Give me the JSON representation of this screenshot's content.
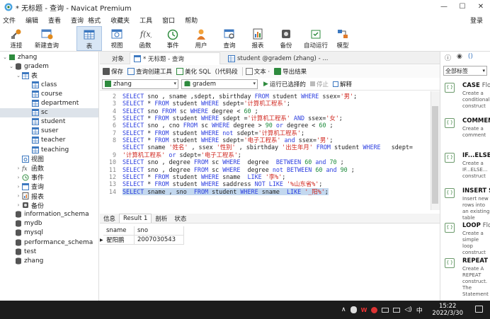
{
  "window": {
    "title": "* 无标题 - 查询 - Navicat Premium",
    "controls": [
      "—",
      "☐",
      "✕"
    ]
  },
  "menu": {
    "items": [
      "文件",
      "编辑",
      "查看",
      "查询",
      "格式",
      "收藏夹",
      "工具",
      "窗口",
      "帮助"
    ],
    "login": "登录"
  },
  "toolbar": {
    "buttons": [
      {
        "label": "连接",
        "icon": "connect-icon"
      },
      {
        "label": "新建查询",
        "icon": "new-query-icon"
      },
      {
        "label": "表",
        "icon": "table-icon"
      },
      {
        "label": "视图",
        "icon": "view-icon"
      },
      {
        "label": "函数",
        "icon": "function-icon"
      },
      {
        "label": "事件",
        "icon": "event-icon"
      },
      {
        "label": "用户",
        "icon": "user-icon"
      },
      {
        "label": "查询",
        "icon": "query-icon"
      },
      {
        "label": "报表",
        "icon": "report-icon"
      },
      {
        "label": "备份",
        "icon": "backup-icon"
      },
      {
        "label": "自动运行",
        "icon": "autorun-icon"
      },
      {
        "label": "模型",
        "icon": "model-icon"
      }
    ]
  },
  "nav": {
    "tree": [
      {
        "label": "zhang",
        "level": 0,
        "arrow": "⌄",
        "icon": "connection"
      },
      {
        "label": "gradem",
        "level": 1,
        "arrow": "⌄",
        "icon": "database"
      },
      {
        "label": "表",
        "level": 2,
        "arrow": "⌄",
        "icon": "tables"
      },
      {
        "label": "class",
        "level": 3,
        "arrow": "",
        "icon": "table"
      },
      {
        "label": "course",
        "level": 3,
        "arrow": "",
        "icon": "table"
      },
      {
        "label": "department",
        "level": 3,
        "arrow": "",
        "icon": "table"
      },
      {
        "label": "sc",
        "level": 3,
        "arrow": "",
        "icon": "table",
        "selected": true
      },
      {
        "label": "student",
        "level": 3,
        "arrow": "",
        "icon": "table"
      },
      {
        "label": "suser",
        "level": 3,
        "arrow": "",
        "icon": "table"
      },
      {
        "label": "teacher",
        "level": 3,
        "arrow": "",
        "icon": "table"
      },
      {
        "label": "teaching",
        "level": 3,
        "arrow": "",
        "icon": "table"
      },
      {
        "label": "视图",
        "level": 2,
        "arrow": "",
        "icon": "view"
      },
      {
        "label": "函数",
        "level": 2,
        "arrow": "›",
        "icon": "function"
      },
      {
        "label": "事件",
        "level": 2,
        "arrow": "›",
        "icon": "event"
      },
      {
        "label": "查询",
        "level": 2,
        "arrow": "›",
        "icon": "query"
      },
      {
        "label": "报表",
        "level": 2,
        "arrow": "›",
        "icon": "report"
      },
      {
        "label": "备份",
        "level": 2,
        "arrow": "›",
        "icon": "backup"
      },
      {
        "label": "information_schema",
        "level": 1,
        "arrow": "",
        "icon": "database"
      },
      {
        "label": "mydb",
        "level": 1,
        "arrow": "",
        "icon": "database"
      },
      {
        "label": "mysql",
        "level": 1,
        "arrow": "",
        "icon": "database"
      },
      {
        "label": "performance_schema",
        "level": 1,
        "arrow": "",
        "icon": "database"
      },
      {
        "label": "test",
        "level": 1,
        "arrow": "",
        "icon": "database"
      },
      {
        "label": "zhang",
        "level": 1,
        "arrow": "",
        "icon": "database"
      }
    ]
  },
  "tabs": {
    "objects": "对象",
    "active": "* 无标题 - 查询",
    "other": "student @gradem (zhang) - ..."
  },
  "qtool": {
    "save": "保存",
    "builder": "查询创建工具",
    "beautify": "美化 SQL",
    "snippet": "()代码段",
    "text": "文本 ·",
    "export": "导出结果"
  },
  "selectors": {
    "connection": "zhang",
    "database": "gradem",
    "run": "运行已选择的",
    "stop": "停止",
    "explain": "解释"
  },
  "editor": {
    "lines": [
      [
        [
          "kw",
          "SELECT "
        ],
        [
          "pl",
          "sno , sname ,sdept, sbirthday "
        ],
        [
          "kw",
          "FROM "
        ],
        [
          "pl",
          "student "
        ],
        [
          "kw",
          "WHERE "
        ],
        [
          "pl",
          "ssex="
        ],
        [
          "st",
          "'男'"
        ],
        [
          "pl",
          ";"
        ]
      ],
      [
        [
          "kw",
          "SELECT "
        ],
        [
          "pl",
          "* "
        ],
        [
          "kw",
          "FROM "
        ],
        [
          "pl",
          "student "
        ],
        [
          "kw",
          "WHERE "
        ],
        [
          "pl",
          "sdept="
        ],
        [
          "st",
          "'计算机工程系'"
        ],
        [
          "pl",
          ";"
        ]
      ],
      [
        [
          "kw",
          "SELECT "
        ],
        [
          "pl",
          "sno "
        ],
        [
          "kw",
          "FROM "
        ],
        [
          "pl",
          "sc "
        ],
        [
          "kw",
          "WHERE "
        ],
        [
          "pl",
          "degree < "
        ],
        [
          "nm",
          "60"
        ],
        [
          "pl",
          " ;"
        ]
      ],
      [
        [
          "kw",
          "SELECT "
        ],
        [
          "pl",
          "* "
        ],
        [
          "kw",
          "FROM "
        ],
        [
          "pl",
          "student "
        ],
        [
          "kw",
          "WHERE "
        ],
        [
          "pl",
          "sdept ="
        ],
        [
          "st",
          "'计算机工程系'"
        ],
        [
          "pl",
          " "
        ],
        [
          "kw",
          "AND "
        ],
        [
          "pl",
          "ssex="
        ],
        [
          "st",
          "'女'"
        ],
        [
          "pl",
          ";"
        ]
      ],
      [
        [
          "kw",
          "SELECT "
        ],
        [
          "pl",
          "sno , cno "
        ],
        [
          "kw",
          "FROM "
        ],
        [
          "pl",
          "sc "
        ],
        [
          "kw",
          "WHERE "
        ],
        [
          "pl",
          "degree > "
        ],
        [
          "nm",
          "90"
        ],
        [
          "pl",
          " "
        ],
        [
          "kw",
          "or "
        ],
        [
          "pl",
          "degree < "
        ],
        [
          "nm",
          "60"
        ],
        [
          "pl",
          " ;"
        ]
      ],
      [
        [
          "kw",
          "SELECT "
        ],
        [
          "pl",
          "* "
        ],
        [
          "kw",
          "FROM "
        ],
        [
          "pl",
          "student "
        ],
        [
          "kw",
          "WHERE not "
        ],
        [
          "pl",
          "sdept="
        ],
        [
          "st",
          "'计算机工程系'"
        ],
        [
          "pl",
          ";"
        ]
      ],
      [
        [
          "kw",
          "SELECT "
        ],
        [
          "pl",
          "* "
        ],
        [
          "kw",
          "FROM "
        ],
        [
          "pl",
          "student "
        ],
        [
          "kw",
          "WHERE "
        ],
        [
          "pl",
          "sdept="
        ],
        [
          "st",
          "'电子工程系'"
        ],
        [
          "pl",
          " "
        ],
        [
          "kw",
          "and "
        ],
        [
          "pl",
          "ssex="
        ],
        [
          "st",
          "'男'"
        ],
        [
          "pl",
          ";"
        ]
      ],
      [
        [
          "kw",
          "SELECT "
        ],
        [
          "pl",
          "sname "
        ],
        [
          "st",
          "'姓名'"
        ],
        [
          "pl",
          " , ssex "
        ],
        [
          "st",
          "'性别'"
        ],
        [
          "pl",
          " , sbirthday "
        ],
        [
          "st",
          "'出生年月'"
        ],
        [
          "pl",
          " "
        ],
        [
          "kw",
          "FROM "
        ],
        [
          "pl",
          "student "
        ],
        [
          "kw",
          "WHERE "
        ],
        [
          "pl",
          "  sdept="
        ]
      ],
      [
        [
          "st",
          "'计算机工程系'"
        ],
        [
          "pl",
          " "
        ],
        [
          "kw",
          "or "
        ],
        [
          "pl",
          "sdept="
        ],
        [
          "st",
          "'电子工程系'"
        ],
        [
          "pl",
          ";"
        ]
      ],
      [
        [
          "kw",
          "SELECT "
        ],
        [
          "pl",
          "sno , degree "
        ],
        [
          "kw",
          "FROM "
        ],
        [
          "pl",
          "sc "
        ],
        [
          "kw",
          "WHERE  "
        ],
        [
          "pl",
          "degree  "
        ],
        [
          "kw",
          "BETWEEN "
        ],
        [
          "nm",
          "60"
        ],
        [
          "pl",
          " "
        ],
        [
          "kw",
          "and "
        ],
        [
          "nm",
          "70"
        ],
        [
          "pl",
          " ;"
        ]
      ],
      [
        [
          "kw",
          "SELECT "
        ],
        [
          "pl",
          "sno , degree "
        ],
        [
          "kw",
          "FROM "
        ],
        [
          "pl",
          "sc "
        ],
        [
          "kw",
          "WHERE  "
        ],
        [
          "pl",
          "degree "
        ],
        [
          "kw",
          "not BETWEEN "
        ],
        [
          "nm",
          "60"
        ],
        [
          "pl",
          " "
        ],
        [
          "kw",
          "and "
        ],
        [
          "nm",
          "90"
        ],
        [
          "pl",
          " ;"
        ]
      ],
      [
        [
          "kw",
          "SELECT "
        ],
        [
          "pl",
          "* "
        ],
        [
          "kw",
          "FROM "
        ],
        [
          "pl",
          "student "
        ],
        [
          "kw",
          "WHERE "
        ],
        [
          "pl",
          "sname  "
        ],
        [
          "kw",
          "LIKE "
        ],
        [
          "st",
          "'李%'"
        ],
        [
          "pl",
          ";"
        ]
      ],
      [
        [
          "kw",
          "SELECT "
        ],
        [
          "pl",
          "* "
        ],
        [
          "kw",
          "FROM "
        ],
        [
          "pl",
          "student "
        ],
        [
          "kw",
          "WHERE "
        ],
        [
          "pl",
          "saddress "
        ],
        [
          "kw",
          "NOT LIKE "
        ],
        [
          "st",
          "'%山东省%'"
        ],
        [
          "pl",
          ";"
        ]
      ],
      [
        [
          "kw",
          "SELECT "
        ],
        [
          "pl",
          "sname , sno  "
        ],
        [
          "kw",
          "FROM "
        ],
        [
          "pl",
          "student "
        ],
        [
          "kw",
          "WHERE "
        ],
        [
          "pl",
          "sname  "
        ],
        [
          "kw",
          "LIKE "
        ],
        [
          "st",
          "'_阳%'"
        ],
        [
          "pl",
          ";"
        ]
      ]
    ],
    "numbers": [
      "2",
      "3",
      "4",
      "5",
      "6",
      "7",
      "8",
      "",
      "9",
      "10",
      "11",
      "12",
      "13",
      "14"
    ],
    "highlight_index": 13
  },
  "results": {
    "tabs": [
      "信息",
      "Result 1",
      "剖析",
      "状态"
    ],
    "active": 1,
    "columns": [
      "sname",
      "sno"
    ],
    "rows": [
      [
        "翟阳鹏",
        "2007030543"
      ]
    ]
  },
  "right": {
    "filter": "全部标签",
    "snippets": [
      {
        "title": "CASE",
        "more": "Flow",
        "desc": "Create a conditional construct"
      },
      {
        "title": "COMMEN",
        "more": "",
        "desc": "Create a comment"
      },
      {
        "title": "IF...ELSE...",
        "more": "",
        "desc": "Create a IF...ELSE... construct"
      },
      {
        "title": "INSERT Sy",
        "more": "",
        "desc": "Insert new rows into an existing table"
      },
      {
        "title": "LOOP",
        "more": "Flow",
        "desc": "Create a simple loop construct"
      },
      {
        "title": "REPEAT",
        "more": "Fl",
        "desc": "Create A REPEAT construct. The Statement"
      }
    ]
  },
  "taskbar": {
    "time": "15:22",
    "date": "2022/3/30",
    "ime": "中",
    "tray": "∧"
  },
  "colors": {
    "accent": "#2d3fe0",
    "string": "#d0261e",
    "number": "#1b8a3a",
    "highlight": "#c3d8ef",
    "taskbar": "#1c1c1c"
  }
}
